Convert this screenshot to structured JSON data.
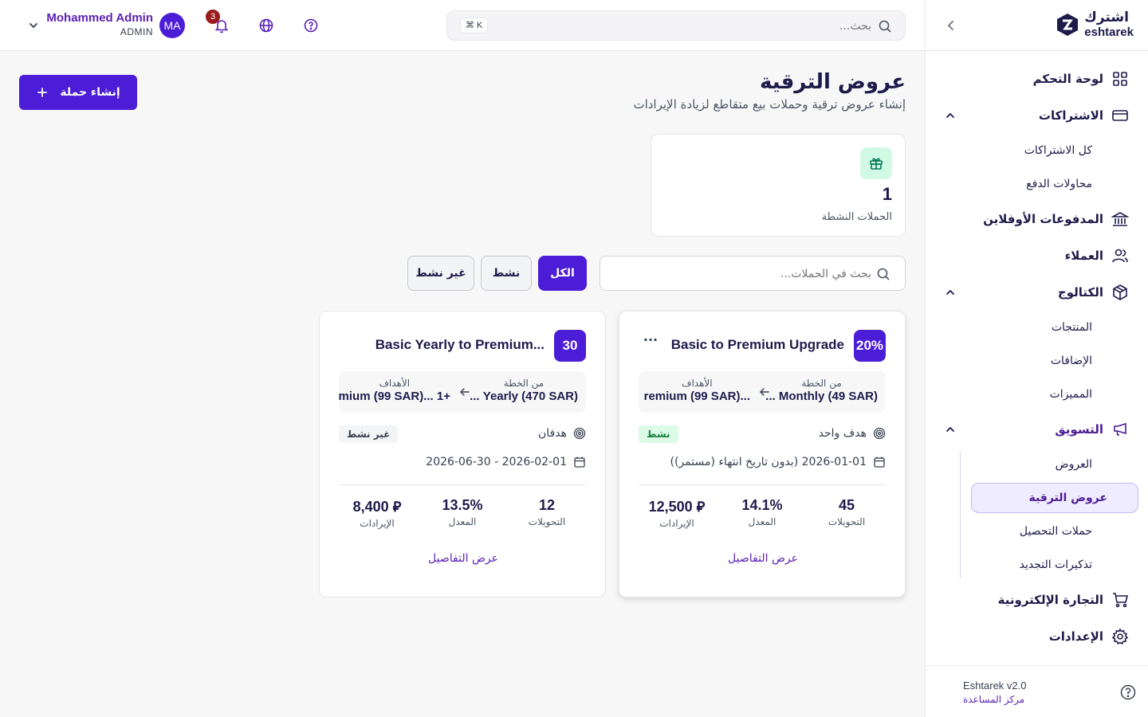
{
  "brand": {
    "name_ar": "اشترك",
    "name_en": "eshtarek"
  },
  "sidebar": {
    "items": [
      {
        "label": "لوحة التحكم"
      },
      {
        "label": "الاشتراكات",
        "children": [
          "كل الاشتراكات",
          "محاولات الدفع"
        ]
      },
      {
        "label": "المدفوعات الأوفلاين"
      },
      {
        "label": "العملاء"
      },
      {
        "label": "الكتالوج",
        "children": [
          "المنتجات",
          "الإضافات",
          "المميزات"
        ]
      },
      {
        "label": "التسويق",
        "children": [
          "العروض",
          "عروض الترقية",
          "حملات التحصيل",
          "تذكيرات التجديد"
        ]
      },
      {
        "label": "التجارة الإلكترونية"
      },
      {
        "label": "الإعدادات"
      }
    ],
    "version": "Eshtarek v2.0",
    "help_link": "مركز المساعدة"
  },
  "topbar": {
    "search_placeholder": "بحث...",
    "search_shortcut": "⌘ K",
    "notification_count": "3",
    "user": {
      "name": "Mohammed Admin",
      "role": "ADMIN",
      "initials": "MA"
    }
  },
  "page": {
    "title": "عروض الترقية",
    "subtitle": "إنشاء عروض ترقية وحملات بيع متقاطع لزيادة الإيرادات",
    "create_button": "إنشاء حملة",
    "stat": {
      "value": "1",
      "label": "الحملات النشطة"
    },
    "filter_search_placeholder": "بحث في الحملات...",
    "filters": [
      "الكل",
      "نشط",
      "غير نشط"
    ],
    "active_filter": "الكل"
  },
  "campaigns": [
    {
      "badge": "20%",
      "title": "Basic to Premium Upgrade",
      "more": "···",
      "from_caption": "من الخطة",
      "from_value": "Monthly (49 SAR) ...",
      "to_caption": "الأهداف",
      "to_value": "...remium (99 SAR)",
      "targets": "هدف واحد",
      "status": "نشط",
      "dates": "2026-01-01 (بدون تاريخ انتهاء (مستمر))",
      "conversions": "45",
      "conversions_label": "التحويلات",
      "rate": "14.1%",
      "rate_label": "المعدل",
      "revenue": "12,500 ⃁",
      "revenue_label": "الإيرادات",
      "details": "عرض التفاصيل"
    },
    {
      "badge": "30",
      "title": "Basic Yearly to Premium...",
      "from_caption": "من الخطة",
      "from_value": "Yearly (470 SAR) ...",
      "to_caption": "الأهداف",
      "to_value": "+1 ...mium (99 SAR)",
      "targets": "هدفان",
      "status": "غير نشط",
      "dates": "2026-02-01 - 2026-06-30",
      "conversions": "12",
      "conversions_label": "التحويلات",
      "rate": "13.5%",
      "rate_label": "المعدل",
      "revenue": "8,400 ⃁",
      "revenue_label": "الإيرادات",
      "details": "عرض التفاصيل"
    }
  ],
  "colors": {
    "primary": "#4c1dd6",
    "navy": "#1e1b4b",
    "active_green": "#15803d",
    "badge_red": "#991b1b"
  }
}
